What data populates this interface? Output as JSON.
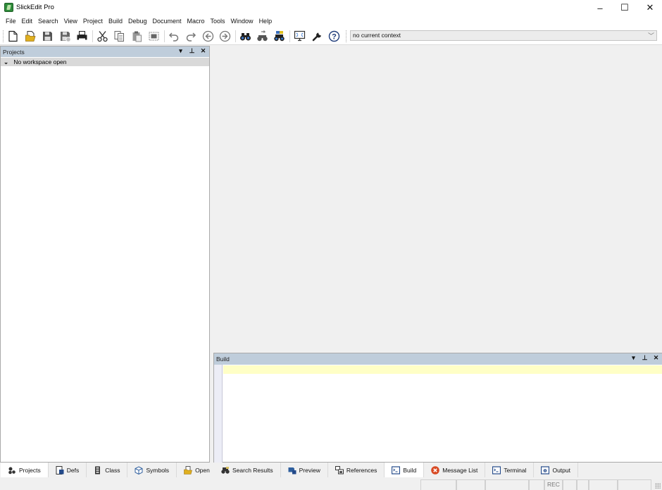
{
  "window": {
    "title": "SlickEdit Pro",
    "icon": "slickedit-logo-icon",
    "controls": {
      "minimize": "–",
      "maximize": "☐",
      "close": "✕"
    }
  },
  "menubar": {
    "items": [
      "File",
      "Edit",
      "Search",
      "View",
      "Project",
      "Build",
      "Debug",
      "Document",
      "Macro",
      "Tools",
      "Window",
      "Help"
    ]
  },
  "toolbar": {
    "buttons": [
      {
        "name": "new-file",
        "icon": "new-file-icon"
      },
      {
        "name": "open-file",
        "icon": "open-folder-icon"
      },
      {
        "name": "save",
        "icon": "save-icon"
      },
      {
        "name": "save-all",
        "icon": "save-all-icon"
      },
      {
        "name": "print",
        "icon": "print-icon"
      },
      {
        "name": "cut",
        "icon": "cut-icon"
      },
      {
        "name": "copy",
        "icon": "copy-icon"
      },
      {
        "name": "paste",
        "icon": "paste-icon"
      },
      {
        "name": "select",
        "icon": "select-block-icon"
      },
      {
        "name": "undo",
        "icon": "undo-icon"
      },
      {
        "name": "redo",
        "icon": "redo-icon"
      },
      {
        "name": "back",
        "icon": "back-arrow-icon"
      },
      {
        "name": "forward",
        "icon": "forward-arrow-icon"
      },
      {
        "name": "find",
        "icon": "binoculars-icon"
      },
      {
        "name": "replace",
        "icon": "find-replace-icon"
      },
      {
        "name": "find-in-files",
        "icon": "find-in-files-icon"
      },
      {
        "name": "fullscreen",
        "icon": "fullscreen-monitor-icon"
      },
      {
        "name": "options",
        "icon": "wrench-icon"
      },
      {
        "name": "help",
        "icon": "help-icon"
      }
    ],
    "context": {
      "value": "no current context"
    }
  },
  "projects_panel": {
    "title": "Projects",
    "controls": {
      "menu": "▾",
      "pin": "⊥",
      "close": "✕"
    },
    "tree": [
      {
        "label": "No workspace open",
        "expanded": true
      }
    ]
  },
  "build_panel": {
    "title": "Build",
    "controls": {
      "menu": "▾",
      "pin": "⊥",
      "close": "✕"
    },
    "colors": {
      "current_line": "#ffffc6",
      "gutter": "#ecedf6"
    }
  },
  "left_tabs": [
    {
      "label": "Projects",
      "icon": "projects-icon",
      "active": true
    },
    {
      "label": "Defs",
      "icon": "defs-icon",
      "active": false
    },
    {
      "label": "Class",
      "icon": "class-icon",
      "active": false
    },
    {
      "label": "Symbols",
      "icon": "symbols-icon",
      "active": false
    },
    {
      "label": "Open",
      "icon": "open-icon",
      "active": false
    }
  ],
  "bottom_tabs": [
    {
      "label": "Search Results",
      "icon": "search-results-icon",
      "active": false
    },
    {
      "label": "Preview",
      "icon": "preview-icon",
      "active": false
    },
    {
      "label": "References",
      "icon": "references-icon",
      "active": false
    },
    {
      "label": "Build",
      "icon": "build-icon",
      "active": true
    },
    {
      "label": "Message List",
      "icon": "message-list-icon",
      "active": false
    },
    {
      "label": "Terminal",
      "icon": "terminal-icon",
      "active": false
    },
    {
      "label": "Output",
      "icon": "output-icon",
      "active": false
    }
  ],
  "statusbar": {
    "cells": [
      "",
      "",
      "",
      "",
      "REC",
      "",
      "",
      "",
      ""
    ]
  },
  "colors": {
    "panel_header": "#bfcddb",
    "selected_tree_row": "#d9d9d9",
    "background": "#f0f0f0"
  }
}
